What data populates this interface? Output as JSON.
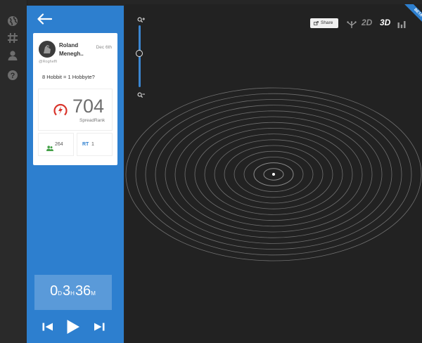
{
  "rail": {
    "icons": [
      "globe-icon",
      "hashtag-icon",
      "user-icon",
      "help-icon"
    ]
  },
  "panel": {
    "back_icon": "arrow-left-icon",
    "tweet": {
      "author": "Roland Menegh..",
      "date": "Dec 6th",
      "handle": "@Rogheffi",
      "text": "8 Hobbit = 1 Hobbyte?"
    },
    "spread": {
      "value": "704",
      "label": "SpreadRank"
    },
    "stats": {
      "followers": "264",
      "retweets_label": "RT",
      "retweets": "1"
    },
    "timer": {
      "days": "0",
      "days_unit": "D",
      "hours": "3",
      "hours_unit": "H",
      "minutes": "36",
      "minutes_unit": "M"
    },
    "controls": [
      "skip-back-icon",
      "play-icon",
      "skip-forward-icon"
    ]
  },
  "canvas": {
    "zoom_level": 0.55,
    "share_label": "Share",
    "views": {
      "twod": "2D",
      "threed": "3D"
    },
    "active_view": "3D",
    "badge": "BETA",
    "ring_count": 15,
    "colors": {
      "accent": "#2d7fcf",
      "ring": "#8a8a8a",
      "background": "#222222"
    }
  }
}
